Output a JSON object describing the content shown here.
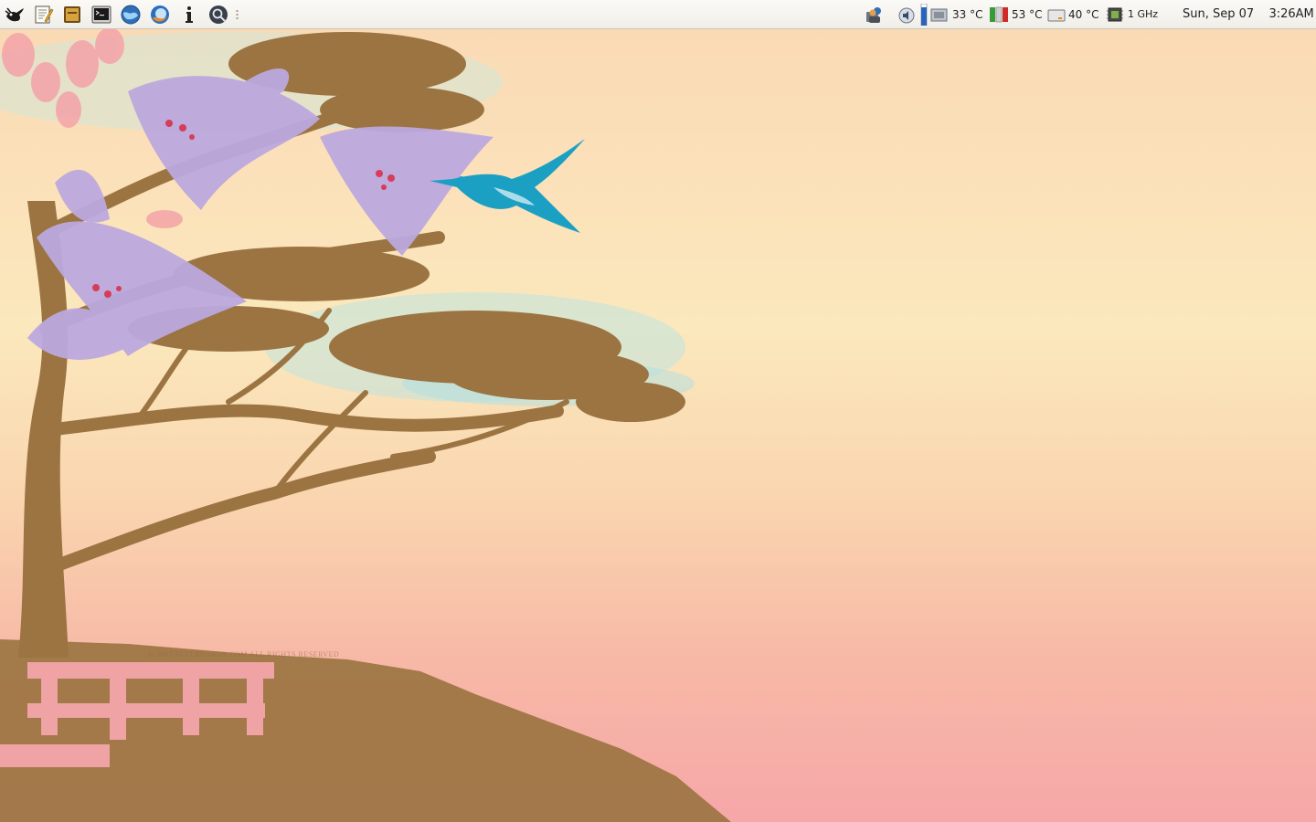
{
  "panel": {
    "launchers": [
      {
        "name": "xfce-mouse-menu-icon"
      },
      {
        "name": "text-editor-icon"
      },
      {
        "name": "file-manager-icon"
      },
      {
        "name": "terminal-icon"
      },
      {
        "name": "web-browser-icon"
      },
      {
        "name": "mail-client-icon"
      },
      {
        "name": "info-icon"
      },
      {
        "name": "search-tool-icon"
      }
    ],
    "tray": {
      "network_icon": "network-users-icon",
      "volume_icon": "speaker-icon",
      "sensors": [
        {
          "name": "motherboard-temp",
          "value": "33 °C"
        },
        {
          "name": "cpu-temp",
          "value": "53 °C"
        },
        {
          "name": "disk-temp",
          "value": "40 °C"
        }
      ],
      "cpufreq": "1 GHz"
    },
    "clock": {
      "date": "Sun, Sep 07",
      "time": "3:26AM"
    }
  },
  "wallpaper": {
    "watermark": "© 2007 FULLREASON.COM ALL RIGHTS RESERVED",
    "colors": {
      "sky_top": "#f9d9b4",
      "sky_mid": "#fbe8bd",
      "sky_bottom": "#f6a7a8",
      "tree": "#9b7442",
      "lily": "#b8a6dc",
      "hummingbird": "#1ba0c4"
    }
  }
}
